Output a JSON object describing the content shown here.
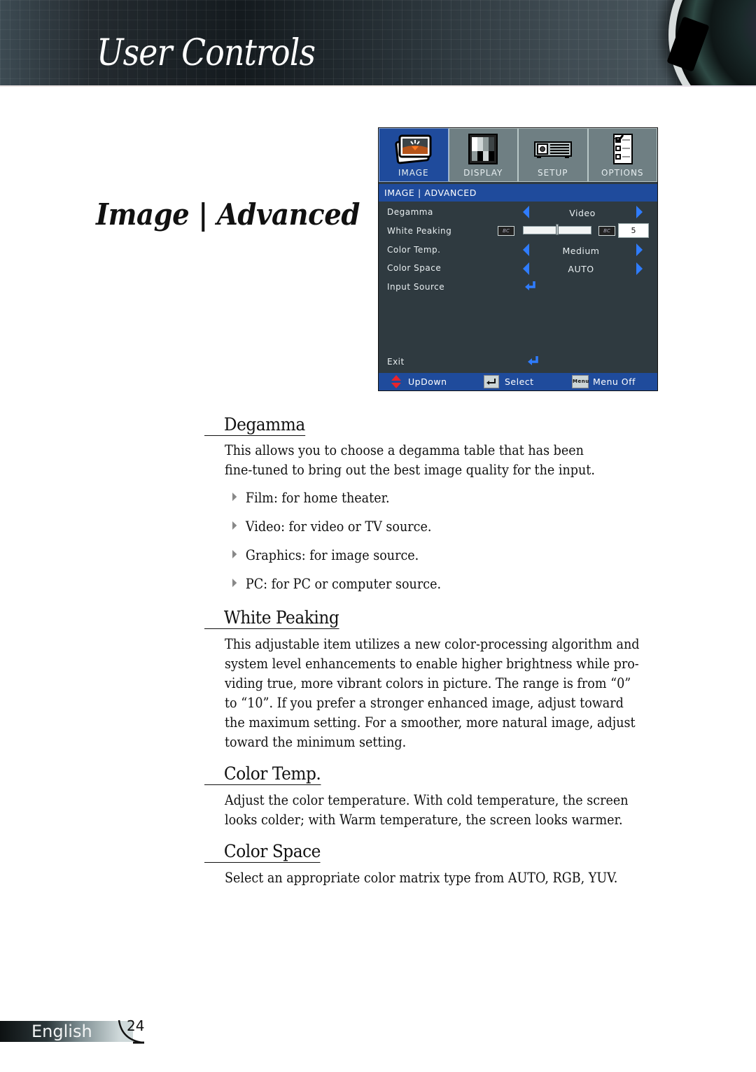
{
  "header": {
    "section_title": "User Controls"
  },
  "page_title": "Image | Advanced",
  "osd": {
    "tabs": [
      {
        "label": "IMAGE",
        "icon": "image-icon",
        "active": true
      },
      {
        "label": "DISPLAY",
        "icon": "display-icon",
        "active": false
      },
      {
        "label": "SETUP",
        "icon": "projector-icon",
        "active": false
      },
      {
        "label": "OPTIONS",
        "icon": "checklist-icon",
        "active": false
      }
    ],
    "subtitle": "IMAGE | ADVANCED",
    "items": [
      {
        "label": "Degamma",
        "control": "selector",
        "value": "Video"
      },
      {
        "label": "White Peaking",
        "control": "slider",
        "value": "5",
        "slider_fraction": 0.5
      },
      {
        "label": "Color Temp.",
        "control": "selector",
        "value": "Medium"
      },
      {
        "label": "Color Space",
        "control": "selector",
        "value": "AUTO"
      },
      {
        "label": "Input Source",
        "control": "enter"
      }
    ],
    "exit_label": "Exit",
    "footer": {
      "updown": "UpDown",
      "select": "Select",
      "menu_icon_text": "Menu",
      "menu_off": "Menu Off"
    },
    "colors": {
      "accent_blue": "#1f4b9c",
      "arrow_blue": "#2f7cff",
      "panel_bg": "#2f3a40",
      "tab_inactive": "#6f7f83"
    }
  },
  "sections": [
    {
      "heading": "Degamma",
      "paragraphs": [
        "This allows you to choose a degamma table that has been",
        "fine-tuned to bring out the best image quality for the input."
      ],
      "bullets": [
        "Film: for home theater.",
        "Video: for video or TV source.",
        "Graphics: for image source.",
        "PC: for PC or computer source."
      ]
    },
    {
      "heading": "White Peaking",
      "paragraphs": [
        "This adjustable item utilizes a new color-processing algorithm and",
        "system level enhancements to enable higher brightness while pro-",
        "viding true, more vibrant colors in picture. The range is from “0”",
        "to “10”. If you prefer a stronger enhanced image, adjust toward",
        "the maximum setting. For a smoother, more natural image, adjust",
        "toward the minimum setting."
      ]
    },
    {
      "heading": "Color Temp.",
      "paragraphs": [
        "Adjust the color temperature. With cold temperature, the screen",
        "looks colder; with Warm temperature, the screen looks warmer."
      ]
    },
    {
      "heading": "Color Space",
      "paragraphs": [
        "Select an appropriate color matrix type from AUTO, RGB, YUV."
      ]
    }
  ],
  "footer": {
    "language": "English",
    "page_number": "24"
  }
}
